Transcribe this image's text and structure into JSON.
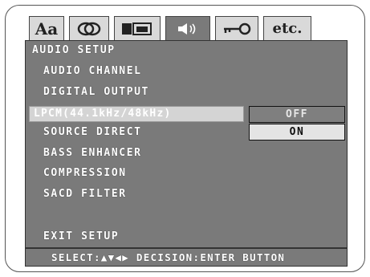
{
  "tabs": [
    {
      "label": "Aa",
      "icon": "language-icon"
    },
    {
      "label": "",
      "icon": "picture-icon"
    },
    {
      "label": "",
      "icon": "display-icon"
    },
    {
      "label": "",
      "icon": "speaker-icon",
      "active": true
    },
    {
      "label": "",
      "icon": "key-icon"
    },
    {
      "label": "etc.",
      "icon": "etc-icon"
    }
  ],
  "menu": {
    "title": "AUDIO SETUP",
    "items": [
      "AUDIO CHANNEL",
      "DIGITAL OUTPUT",
      "LPCM(44.1kHz/48kHz)",
      "SOURCE DIRECT",
      "BASS ENHANCER",
      "COMPRESSION",
      "SACD FILTER"
    ],
    "selected_index": 2,
    "exit": "EXIT SETUP"
  },
  "options": [
    {
      "label": "OFF"
    },
    {
      "label": "ON"
    }
  ],
  "status": "SELECT:▲▼◀▶ DECISION:ENTER BUTTON",
  "colors": {
    "screen_bg": "#7a7a7a",
    "tab_bg": "#d9d9d9",
    "highlight_bg": "#d4d4d4",
    "text": "#ffffff"
  }
}
